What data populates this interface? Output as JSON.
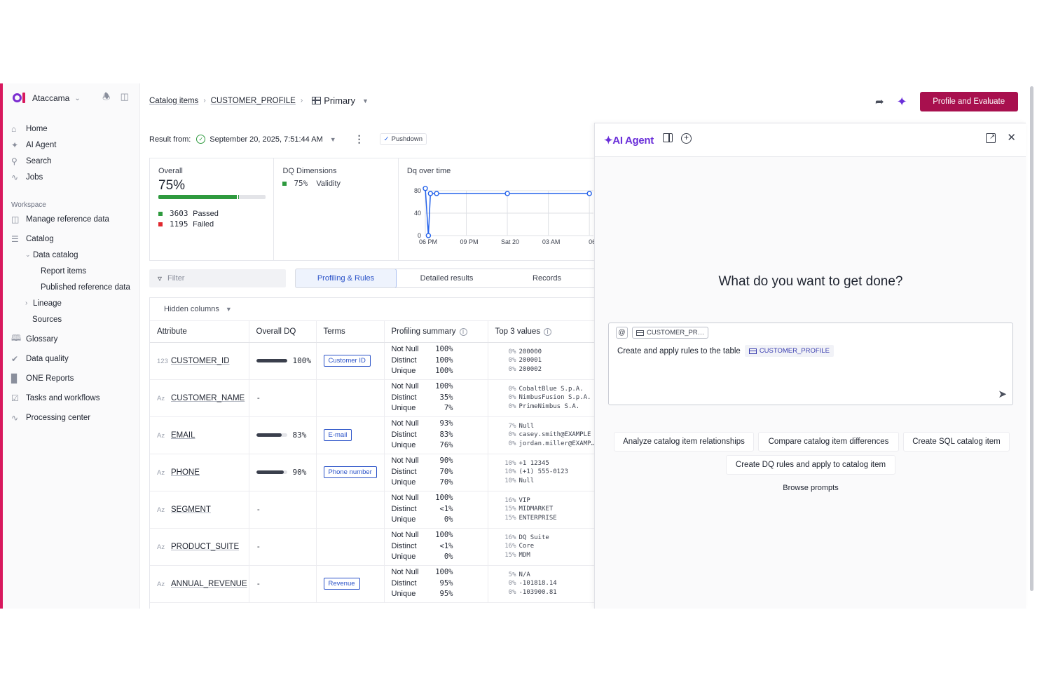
{
  "sidebar": {
    "brand": "Ataccama",
    "nav": [
      {
        "label": "Home",
        "icon": "home-icon"
      },
      {
        "label": "AI Agent",
        "icon": "sparkle-icon"
      },
      {
        "label": "Search",
        "icon": "search-icon"
      },
      {
        "label": "Jobs",
        "icon": "activity-icon"
      }
    ],
    "workspace_label": "Workspace",
    "workspace": {
      "manage_reference": "Manage reference data",
      "catalog": "Catalog",
      "data_catalog": "Data catalog",
      "report_items": "Report items",
      "published_reference": "Published reference data",
      "lineage": "Lineage",
      "sources": "Sources",
      "glossary": "Glossary",
      "data_quality": "Data quality",
      "one_reports": "ONE Reports",
      "tasks": "Tasks and workflows",
      "processing": "Processing center"
    }
  },
  "header": {
    "crumb1": "Catalog items",
    "crumb2": "CUSTOMER_PROFILE",
    "crumb3": "Primary",
    "action_button": "Profile and Evaluate"
  },
  "result": {
    "label": "Result from:",
    "date": "September 20, 2025, 7:51:44 AM",
    "pushdown": "Pushdown"
  },
  "stats": {
    "overall_title": "Overall",
    "overall_value": "75%",
    "overall_fraction": 0.75,
    "passed_count": "3603",
    "passed_label": "Passed",
    "failed_count": "1195",
    "failed_label": "Failed",
    "dims_title": "DQ Dimensions",
    "dim_pct": "75%",
    "dim_name": "Validity",
    "chart_title": "Dq over time"
  },
  "chart_data": {
    "type": "line",
    "title": "Dq over time",
    "x_tick_labels": [
      "06 PM",
      "09 PM",
      "Sat 20",
      "03 AM",
      "06"
    ],
    "y_tick_labels": [
      "0",
      "40",
      "80"
    ],
    "ylim": [
      0,
      80
    ],
    "series": [
      {
        "points": [
          [
            0.0,
            84
          ],
          [
            0.15,
            0
          ],
          [
            0.25,
            75
          ],
          [
            0.55,
            75
          ],
          [
            4.0,
            75
          ],
          [
            8.0,
            75
          ]
        ]
      }
    ],
    "x_range_hours": [
      0,
      8.2
    ],
    "grid": true,
    "color": "#2563eb"
  },
  "filter": {
    "placeholder": "Filter"
  },
  "tabs": [
    "Profiling & Rules",
    "Detailed results",
    "Records"
  ],
  "table": {
    "hidden_columns": "Hidden columns",
    "headers": [
      "Attribute",
      "Overall DQ",
      "Terms",
      "Profiling summary",
      "Top 3 values"
    ],
    "profile_keys": [
      "Not Null",
      "Distinct",
      "Unique"
    ],
    "rows": [
      {
        "type": "123",
        "name": "CUSTOMER_ID",
        "dq": "100%",
        "dq_frac": 1.0,
        "term": "Customer ID",
        "profile": [
          "100%",
          "100%",
          "100%"
        ],
        "top": [
          [
            "0%",
            "200000"
          ],
          [
            "0%",
            "200001"
          ],
          [
            "0%",
            "200002"
          ]
        ]
      },
      {
        "type": "Az",
        "name": "CUSTOMER_NAME",
        "dq": "-",
        "dq_frac": null,
        "term": "",
        "profile": [
          "100%",
          "35%",
          "7%"
        ],
        "top": [
          [
            "0%",
            "CobaltBlue S.p.A."
          ],
          [
            "0%",
            "NimbusFusion S.p.A."
          ],
          [
            "0%",
            "PrimeNimbus S.A."
          ]
        ]
      },
      {
        "type": "Az",
        "name": "EMAIL",
        "dq": "83%",
        "dq_frac": 0.83,
        "term": "E-mail",
        "profile": [
          "93%",
          "83%",
          "76%"
        ],
        "top": [
          [
            "7%",
            "Null"
          ],
          [
            "0%",
            "casey.smith@EXAMPLE"
          ],
          [
            "0%",
            "jordan.miller@EXAMP…"
          ]
        ]
      },
      {
        "type": "Az",
        "name": "PHONE",
        "dq": "90%",
        "dq_frac": 0.9,
        "term": "Phone number",
        "profile": [
          "90%",
          "70%",
          "70%"
        ],
        "top": [
          [
            "10%",
            "+1 12345"
          ],
          [
            "10%",
            "(+1) 555-0123"
          ],
          [
            "10%",
            "Null"
          ]
        ]
      },
      {
        "type": "Az",
        "name": "SEGMENT",
        "dq": "-",
        "dq_frac": null,
        "term": "",
        "profile": [
          "100%",
          "<1%",
          "0%"
        ],
        "top": [
          [
            "16%",
            "VIP"
          ],
          [
            "15%",
            "MIDMARKET"
          ],
          [
            "15%",
            "ENTERPRISE"
          ]
        ]
      },
      {
        "type": "Az",
        "name": "PRODUCT_SUITE",
        "dq": "-",
        "dq_frac": null,
        "term": "",
        "profile": [
          "100%",
          "<1%",
          "0%"
        ],
        "top": [
          [
            "16%",
            "DQ Suite"
          ],
          [
            "16%",
            "Core"
          ],
          [
            "15%",
            "MDM"
          ]
        ]
      },
      {
        "type": "Az",
        "name": "ANNUAL_REVENUE",
        "dq": "-",
        "dq_frac": null,
        "term": "Revenue",
        "profile": [
          "100%",
          "95%",
          "95%"
        ],
        "top": [
          [
            "5%",
            "N/A"
          ],
          [
            "0%",
            "-101818.14"
          ],
          [
            "0%",
            "-103900.81"
          ]
        ]
      }
    ]
  },
  "agent": {
    "title": "AI Agent",
    "question": "What do you want to get done?",
    "context_chip": "CUSTOMER_PR…",
    "prompt_text": "Create and apply rules to the table",
    "prompt_ref": "CUSTOMER_PROFILE",
    "suggestions": [
      "Analyze catalog item relationships",
      "Compare catalog item differences",
      "Create SQL catalog item",
      "Create DQ rules and apply to catalog item"
    ],
    "browse": "Browse prompts"
  },
  "colors": {
    "brand_purple": "#7b2cd0",
    "brand_magenta": "#d8185d",
    "primary_button": "#a8104e",
    "passed": "#2e9a3e",
    "failed": "#e0282e",
    "link_blue": "#2a52c8",
    "ai_purple": "#6a2fd9"
  }
}
